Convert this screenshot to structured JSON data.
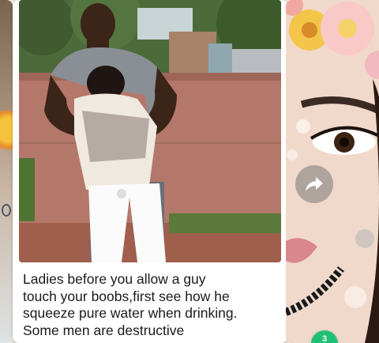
{
  "post": {
    "text_lines": [
      "Ladies before you allow a guy",
      "touch your boobs,first see how he",
      "squeeze pure water when drinking.",
      "Some men are destructive"
    ]
  },
  "share": {
    "icon": "share-arrow-icon"
  },
  "badge": {
    "count": "3",
    "color": "#1fbf75"
  },
  "colors": {
    "card_bg": "#ffffff",
    "page_bg": "#e9e6e2",
    "text": "#1a1a1a"
  }
}
